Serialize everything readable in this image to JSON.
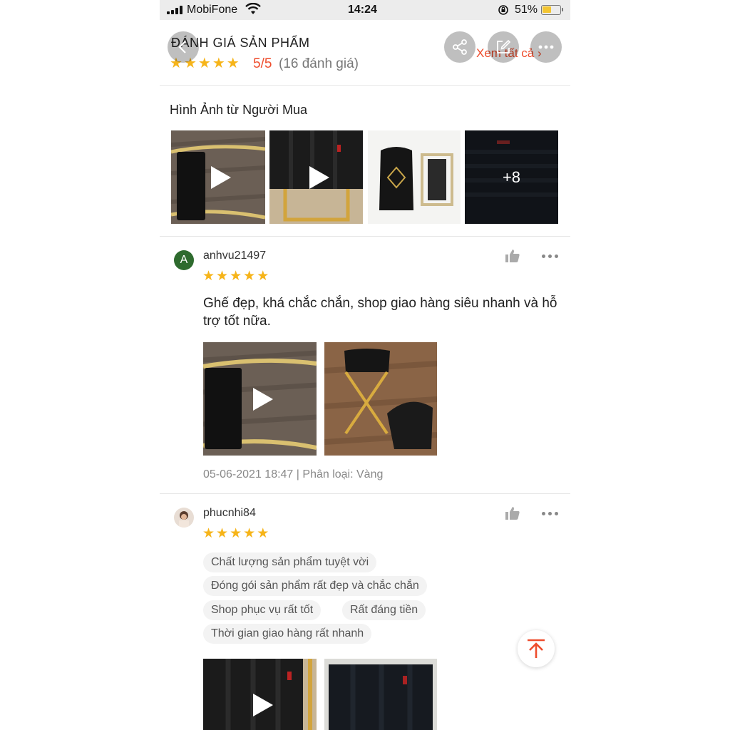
{
  "status_bar": {
    "carrier": "MobiFone",
    "time": "14:24",
    "battery_percent": "51%",
    "battery_level": 0.51,
    "battery_color": "#f3c531"
  },
  "rating_header": {
    "title": "ĐÁNH GIÁ SẢN PHẨM",
    "score": "5/5",
    "count": "(16 đánh giá)",
    "see_all": "Xem tất cả",
    "stars": 5,
    "accent_color": "#ee4d2d",
    "star_color": "#f6b419",
    "overlay_icons": [
      "back-arrow-icon",
      "share-icon",
      "edit-icon",
      "more-icon"
    ]
  },
  "buyer_photos": {
    "title": "Hình Ảnh từ Người Mua",
    "more_count": "+8",
    "items": [
      {
        "kind": "video",
        "icon": "play-icon"
      },
      {
        "kind": "video",
        "icon": "play-icon"
      },
      {
        "kind": "photo"
      },
      {
        "kind": "photo-more"
      }
    ]
  },
  "reviews": [
    {
      "avatar_letter": "A",
      "avatar_color": "#2e6b2e",
      "username": "anhvu21497",
      "stars": 5,
      "text": "Ghế đẹp, khá chắc chắn, shop giao hàng siêu nhanh và hỗ trợ tốt nữa.",
      "date": "05-06-2021 18:47",
      "separator": "|",
      "variation": "Phân loại: Vàng",
      "media": [
        {
          "kind": "video"
        },
        {
          "kind": "photo"
        }
      ]
    },
    {
      "username": "phucnhi84",
      "stars": 5,
      "tags": [
        "Chất lượng sản phẩm tuyệt vời",
        "Đóng gói sản phẩm rất đẹp và chắc chắn",
        "Shop phục vụ rất tốt",
        "Rất đáng tiền",
        "Thời gian giao hàng rất nhanh"
      ],
      "media": [
        {
          "kind": "video"
        },
        {
          "kind": "photo"
        }
      ]
    }
  ]
}
